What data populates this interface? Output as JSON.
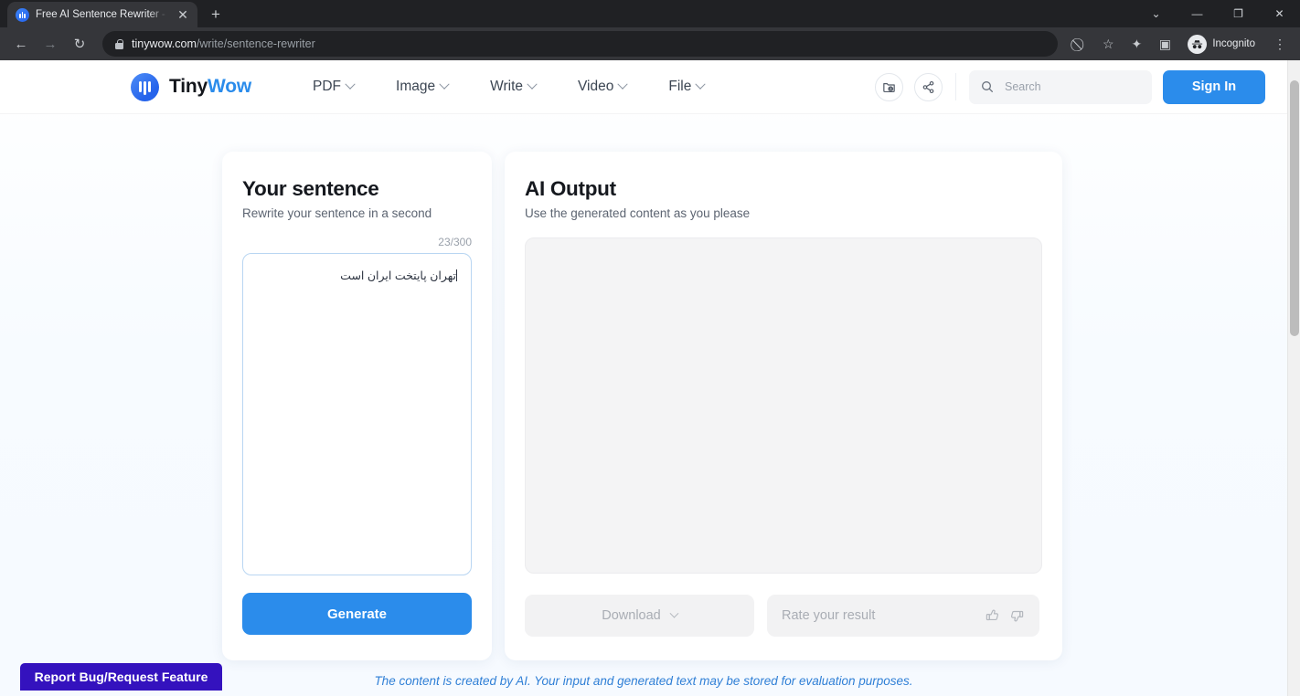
{
  "browser": {
    "tab": {
      "title": "Free AI Sentence Rewriter - No S",
      "favicon": "tinywow-icon",
      "close": "✕"
    },
    "newtab_label": "+",
    "window_controls": {
      "tab_search": "⌄",
      "minimize": "—",
      "maximize": "❐",
      "close": "✕"
    },
    "nav": {
      "back": "←",
      "forward": "→",
      "reload": "↻"
    },
    "omnibox": {
      "lock": "lock-icon",
      "url_domain": "tinywow.com",
      "url_path": "/write/sentence-rewriter"
    },
    "toolbar_icons": {
      "tracking": "⃠",
      "bookmark": "☆",
      "extensions": "✦",
      "side_panel": "▣"
    },
    "profile": {
      "label": "Incognito",
      "icon": "incognito-icon"
    }
  },
  "header": {
    "brand": {
      "name_dark": "Tiny",
      "name_accent": "Wow",
      "logo": "tinywow-logo"
    },
    "nav": [
      {
        "label": "PDF"
      },
      {
        "label": "Image"
      },
      {
        "label": "Write"
      },
      {
        "label": "Video"
      },
      {
        "label": "File"
      }
    ],
    "icons": {
      "cloud_folder": "cloud-folder-icon",
      "share": "share-icon"
    },
    "search": {
      "placeholder": "Search",
      "icon": "search-icon"
    },
    "sign_in": "Sign In"
  },
  "input_card": {
    "title": "Your sentence",
    "subtitle": "Rewrite your sentence in a second",
    "counter": "23/300",
    "text_value": "تهران پایتخت ایران است",
    "generate_label": "Generate"
  },
  "output_card": {
    "title": "AI Output",
    "subtitle": "Use the generated content as you please",
    "output_value": "",
    "download_label": "Download",
    "rate_label": "Rate your result",
    "thumbs_up": "👍",
    "thumbs_down": "👎"
  },
  "footer": {
    "disclaimer": "The content is created by AI. Your input and generated text may be stored for evaluation purposes.",
    "bug_button": "Report Bug/Request Feature"
  },
  "colors": {
    "accent_blue": "#2b8ceb",
    "bug_purple": "#3412be",
    "disclaimer_blue": "#2f7fd6",
    "textarea_border": "#b9d6f2"
  }
}
